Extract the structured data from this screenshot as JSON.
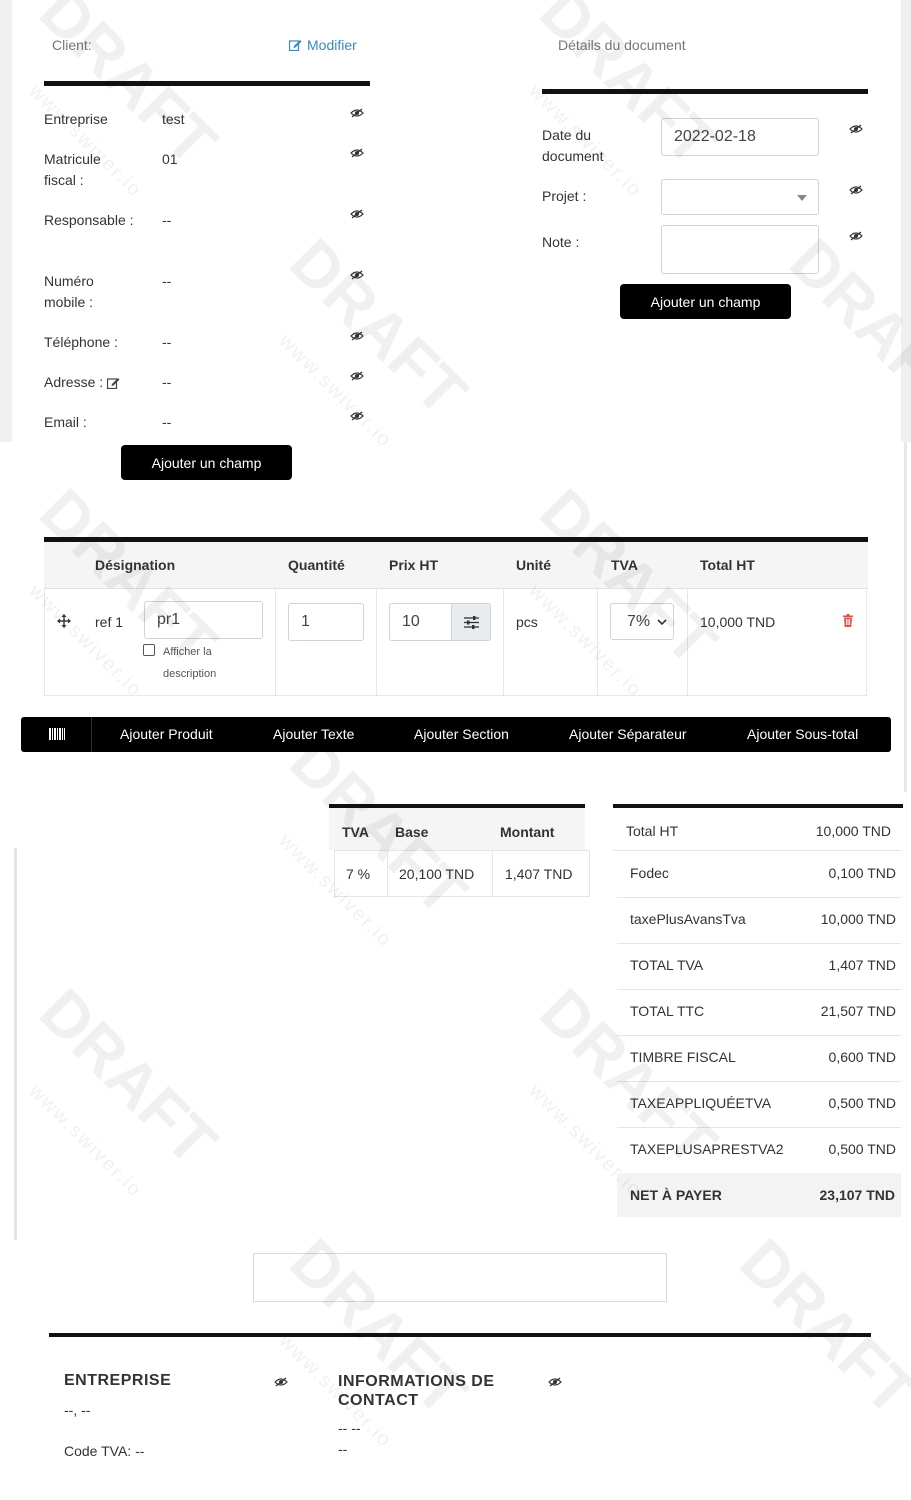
{
  "client": {
    "header_label": "Client:",
    "edit_label": "Modifier",
    "fields": [
      {
        "label": "Entreprise",
        "value": "test"
      },
      {
        "label": "Matricule fiscal :",
        "value": "01"
      },
      {
        "label": "Responsable :",
        "value": "--"
      },
      {
        "label": "Numéro mobile :",
        "value": "--"
      },
      {
        "label": "Téléphone :",
        "value": "--"
      },
      {
        "label": "Adresse :",
        "value": "--"
      },
      {
        "label": "Email :",
        "value": "--"
      }
    ],
    "add_field_label": "Ajouter un champ"
  },
  "document": {
    "header_label": "Détails du document",
    "date_label": "Date du document",
    "date_value": "2022-02-18",
    "project_label": "Projet :",
    "project_value": "",
    "note_label": "Note :",
    "note_value": "",
    "add_field_label": "Ajouter un champ"
  },
  "lines": {
    "headers": [
      "Désignation",
      "Quantité",
      "Prix HT",
      "Unité",
      "TVA",
      "Total HT"
    ],
    "rows": [
      {
        "ref": "ref 1",
        "name": "pr1",
        "show_desc_label": "Afficher la description",
        "qty": "1",
        "price": "10",
        "unit": "pcs",
        "tva": "7%",
        "total": "10,000 TND"
      }
    ]
  },
  "toolbar": {
    "items": [
      "Ajouter Produit",
      "Ajouter Texte",
      "Ajouter Section",
      "Ajouter Séparateur",
      "Ajouter Sous-total"
    ]
  },
  "tva_table": {
    "headers": [
      "TVA",
      "Base",
      "Montant"
    ],
    "rows": [
      {
        "tva": "7 %",
        "base": "20,100 TND",
        "montant": "1,407 TND"
      }
    ]
  },
  "totals": {
    "rows": [
      {
        "label": "Total HT",
        "value": "10,000 TND"
      },
      {
        "label": "Fodec",
        "value": "0,100 TND"
      },
      {
        "label": "taxePlusAvansTva",
        "value": "10,000 TND"
      },
      {
        "label": "TOTAL TVA",
        "value": "1,407 TND"
      },
      {
        "label": "TOTAL TTC",
        "value": "21,507 TND"
      },
      {
        "label": "TIMBRE FISCAL",
        "value": "0,600 TND"
      },
      {
        "label": "TAXEAPPLIQUÉETVA",
        "value": "0,500 TND"
      },
      {
        "label": "TAXEPLUSAPRESTVA2",
        "value": "0,500 TND"
      }
    ],
    "net_label": "NET À PAYER",
    "net_value": "23,107 TND"
  },
  "footer": {
    "company_title": "ENTREPRISE",
    "company_line1": "--, --",
    "company_line2": "Code TVA: --",
    "contact_title": "INFORMATIONS DE CONTACT",
    "contact_line1": "-- --",
    "contact_line2": "--"
  },
  "watermark": {
    "text": "DRAFT",
    "url": "www.swiver.io"
  },
  "colors": {
    "link": "#3a87c8",
    "delete": "#d9534f",
    "black": "#000000"
  }
}
